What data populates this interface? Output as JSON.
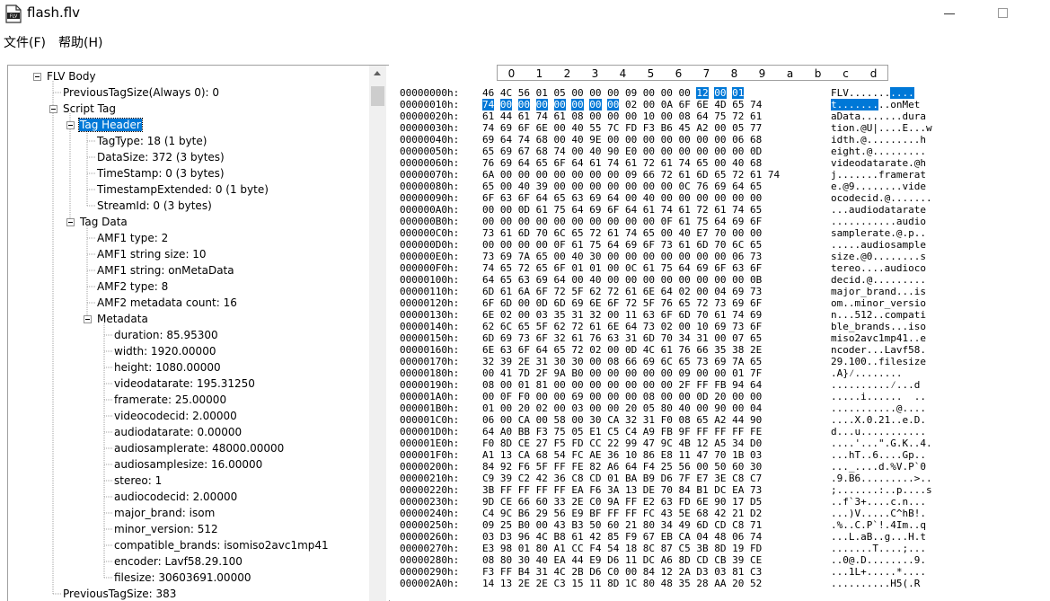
{
  "window": {
    "title": "flash.flv"
  },
  "menu": [
    "文件(F)",
    "帮助(H)"
  ],
  "tree": [
    {
      "label": "FLV Body",
      "level": 0,
      "expander": true
    },
    {
      "label": "PreviousTagSize(Always 0): 0",
      "level": 1
    },
    {
      "label": "Script Tag",
      "level": 1,
      "expander": true
    },
    {
      "label": "Tag Header",
      "level": 2,
      "expander": true,
      "selected": true
    },
    {
      "label": "TagType: 18  (1 byte)",
      "level": 3
    },
    {
      "label": "DataSize: 372  (3 bytes)",
      "level": 3
    },
    {
      "label": "TimeStamp: 0  (3 bytes)",
      "level": 3
    },
    {
      "label": "TimestampExtended: 0  (1 byte)",
      "level": 3
    },
    {
      "label": "StreamId: 0  (3 bytes)",
      "level": 3
    },
    {
      "label": "Tag Data",
      "level": 2,
      "expander": true
    },
    {
      "label": "AMF1 type: 2",
      "level": 3
    },
    {
      "label": "AMF1 string size: 10",
      "level": 3
    },
    {
      "label": "AMF1 string: onMetaData",
      "level": 3
    },
    {
      "label": "AMF2 type: 8",
      "level": 3
    },
    {
      "label": "AMF2 metadata count: 16",
      "level": 3
    },
    {
      "label": "Metadata",
      "level": 3,
      "expander": true
    },
    {
      "label": "duration: 85.95300",
      "level": 4
    },
    {
      "label": "width: 1920.00000",
      "level": 4
    },
    {
      "label": "height: 1080.00000",
      "level": 4
    },
    {
      "label": "videodatarate: 195.31250",
      "level": 4
    },
    {
      "label": "framerate: 25.00000",
      "level": 4
    },
    {
      "label": "videocodecid: 2.00000",
      "level": 4
    },
    {
      "label": "audiodatarate: 0.00000",
      "level": 4
    },
    {
      "label": "audiosamplerate: 48000.00000",
      "level": 4
    },
    {
      "label": "audiosamplesize: 16.00000",
      "level": 4
    },
    {
      "label": "stereo: 1",
      "level": 4
    },
    {
      "label": "audiocodecid: 2.00000",
      "level": 4
    },
    {
      "label": "major_brand: isom",
      "level": 4
    },
    {
      "label": "minor_version: 512",
      "level": 4
    },
    {
      "label": "compatible_brands: isomiso2avc1mp41",
      "level": 4
    },
    {
      "label": "encoder: Lavf58.29.100",
      "level": 4
    },
    {
      "label": "filesize: 30603691.00000",
      "level": 4
    },
    {
      "label": "PreviousTagSize: 383",
      "level": 1
    }
  ],
  "hex_columns": [
    "0",
    "1",
    "2",
    "3",
    "4",
    "5",
    "6",
    "7",
    "8",
    "9",
    "a",
    "b",
    "c",
    "d"
  ],
  "hex_rows": [
    {
      "addr": "00000000h:",
      "bytes": "46 4C 56 01 05 00 00 00 09 00 00 00 12 00 01",
      "ascii": "FLV..........."
    },
    {
      "addr": "00000010h:",
      "bytes": "74 00 00 00 00 00 00 00 02 00 0A 6F 6E 4D 65 74",
      "ascii": "t.........onMet"
    },
    {
      "addr": "00000020h:",
      "bytes": "61 44 61 74 61 08 00 00 00 10 00 08 64 75 72 61",
      "ascii": "aData.......dura"
    },
    {
      "addr": "00000030h:",
      "bytes": "74 69 6F 6E 00 40 55 7C FD F3 B6 45 A2 00 05 77",
      "ascii": "tion.@U|....E...w"
    },
    {
      "addr": "00000040h:",
      "bytes": "69 64 74 68 00 40 9E 00 00 00 00 00 00 00 06 68",
      "ascii": "idth.@.........h"
    },
    {
      "addr": "00000050h:",
      "bytes": "65 69 67 68 74 00 40 90 E0 00 00 00 00 00 00 0D",
      "ascii": "eight.@........."
    },
    {
      "addr": "00000060h:",
      "bytes": "76 69 64 65 6F 64 61 74 61 72 61 74 65 00 40 68",
      "ascii": "videodatarate.@h"
    },
    {
      "addr": "00000070h:",
      "bytes": "6A 00 00 00 00 00 00 00 09 66 72 61 6D 65 72 61 74",
      "ascii": "j.......framerat"
    },
    {
      "addr": "00000080h:",
      "bytes": "65 00 40 39 00 00 00 00 00 00 00 0C 76 69 64 65",
      "ascii": "e.@9........vide"
    },
    {
      "addr": "00000090h:",
      "bytes": "6F 63 6F 64 65 63 69 64 00 40 00 00 00 00 00 00",
      "ascii": "ocodecid.@......."
    },
    {
      "addr": "000000A0h:",
      "bytes": "00 00 0D 61 75 64 69 6F 64 61 74 61 72 61 74 65",
      "ascii": "...audiodatarate"
    },
    {
      "addr": "000000B0h:",
      "bytes": "00 00 00 00 00 00 00 00 00 00 0F 61 75 64 69 6F",
      "ascii": "...........audio"
    },
    {
      "addr": "000000C0h:",
      "bytes": "73 61 6D 70 6C 65 72 61 74 65 00 40 E7 70 00 00",
      "ascii": "samplerate.@.p.."
    },
    {
      "addr": "000000D0h:",
      "bytes": "00 00 00 00 0F 61 75 64 69 6F 73 61 6D 70 6C 65",
      "ascii": ".....audiosample"
    },
    {
      "addr": "000000E0h:",
      "bytes": "73 69 7A 65 00 40 30 00 00 00 00 00 00 00 06 73",
      "ascii": "size.@0........s"
    },
    {
      "addr": "000000F0h:",
      "bytes": "74 65 72 65 6F 01 01 00 0C 61 75 64 69 6F 63 6F",
      "ascii": "tereo....audioco"
    },
    {
      "addr": "00000100h:",
      "bytes": "64 65 63 69 64 00 40 00 00 00 00 00 00 00 00 0B",
      "ascii": "decid.@........."
    },
    {
      "addr": "00000110h:",
      "bytes": "6D 61 6A 6F 72 5F 62 72 61 6E 64 02 00 04 69 73",
      "ascii": "major_brand...is"
    },
    {
      "addr": "00000120h:",
      "bytes": "6F 6D 00 0D 6D 69 6E 6F 72 5F 76 65 72 73 69 6F",
      "ascii": "om..minor_versio"
    },
    {
      "addr": "00000130h:",
      "bytes": "6E 02 00 03 35 31 32 00 11 63 6F 6D 70 61 74 69",
      "ascii": "n...512..compati"
    },
    {
      "addr": "00000140h:",
      "bytes": "62 6C 65 5F 62 72 61 6E 64 73 02 00 10 69 73 6F",
      "ascii": "ble_brands...iso"
    },
    {
      "addr": "00000150h:",
      "bytes": "6D 69 73 6F 32 61 76 63 31 6D 70 34 31 00 07 65",
      "ascii": "miso2avc1mp41..e"
    },
    {
      "addr": "00000160h:",
      "bytes": "6E 63 6F 64 65 72 02 00 0D 4C 61 76 66 35 38 2E",
      "ascii": "ncoder...Lavf58."
    },
    {
      "addr": "00000170h:",
      "bytes": "32 39 2E 31 30 30 00 08 66 69 6C 65 73 69 7A 65",
      "ascii": "29.100..filesize"
    },
    {
      "addr": "00000180h:",
      "bytes": "00 41 7D 2F 9A B0 00 00 00 00 00 09 00 00 01 7F",
      "ascii": ".A}⁄........"
    },
    {
      "addr": "00000190h:",
      "bytes": "08 00 01 81 00 00 00 00 00 00 00 2F FF FB 94 64",
      "ascii": "..........⁄...d"
    },
    {
      "addr": "000001A0h:",
      "bytes": "00 0F F0 00 00 69 00 00 00 08 00 00 0D 20 00 00",
      "ascii": ".....i......  .."
    },
    {
      "addr": "000001B0h:",
      "bytes": "01 00 20 02 00 03 00 00 20 05 80 40 00 90 00 04",
      "ascii": "...........@...."
    },
    {
      "addr": "000001C0h:",
      "bytes": "06 00 CA 00 58 00 30 CA 32 31 F0 08 65 A2 44 90",
      "ascii": "....X.0.21..e.D."
    },
    {
      "addr": "000001D0h:",
      "bytes": "64 A0 BB F3 75 05 E1 C5 C4 A9 FB 9F FF FF FF FE",
      "ascii": "d...u..........."
    },
    {
      "addr": "000001E0h:",
      "bytes": "F0 8D CE 27 F5 FD CC 22 99 47 9C 4B 12 A5 34 D0",
      "ascii": "....'...\".G.K..4."
    },
    {
      "addr": "000001F0h:",
      "bytes": "A1 13 CA 68 54 FC AE 36 10 86 E8 11 47 70 1B 03",
      "ascii": "...hT..6....Gp.."
    },
    {
      "addr": "00000200h:",
      "bytes": "84 92 F6 5F FF FE 82 A6 64 F4 25 56 00 50 60 30",
      "ascii": "..._....d.%V.P`0"
    },
    {
      "addr": "00000210h:",
      "bytes": "C9 39 C2 42 36 C8 CD 01 BA B9 D6 7F E7 3E C8 C7",
      "ascii": ".9.B6.........>.."
    },
    {
      "addr": "00000220h:",
      "bytes": "3B FF FF FF FF EA F6 3A 13 DE 70 84 B1 DC EA 73",
      "ascii": ";.......:..p....s"
    },
    {
      "addr": "00000230h:",
      "bytes": "9D CE 66 60 33 2E C0 9A FF E2 63 FD 6E 90 17 D5",
      "ascii": "..f`3+....c.n..."
    },
    {
      "addr": "00000240h:",
      "bytes": "C4 9C B6 29 56 E9 BF FF FF FC 43 5E 68 42 21 D2",
      "ascii": "...)V.....C^hB!."
    },
    {
      "addr": "00000250h:",
      "bytes": "09 25 B0 00 43 B3 50 60 21 80 34 49 6D CD C8 71",
      "ascii": ".%..C.P`!.4Im..q"
    },
    {
      "addr": "00000260h:",
      "bytes": "03 D3 96 4C B8 61 42 85 F9 67 EB CA 04 48 06 74",
      "ascii": "...L.aB..g...H.t"
    },
    {
      "addr": "00000270h:",
      "bytes": "E3 98 01 80 A1 CC F4 54 18 8C 87 C5 3B 8D 19 FD",
      "ascii": ".......T....;..."
    },
    {
      "addr": "00000280h:",
      "bytes": "08 80 30 40 EA 44 E9 D6 11 DC A6 8D CD CB 39 CE",
      "ascii": "..0@.D........9."
    },
    {
      "addr": "00000290h:",
      "bytes": "F3 FF B4 31 4C 2B D6 C0 00 84 12 2A D3 03 81 C3",
      "ascii": "...1L+.....*...."
    },
    {
      "addr": "000002A0h:",
      "bytes": "14 13 2E 2E C3 15 11 8D 1C 80 48 35 28 AA 20 52",
      "ascii": "..........H5(.R"
    }
  ]
}
